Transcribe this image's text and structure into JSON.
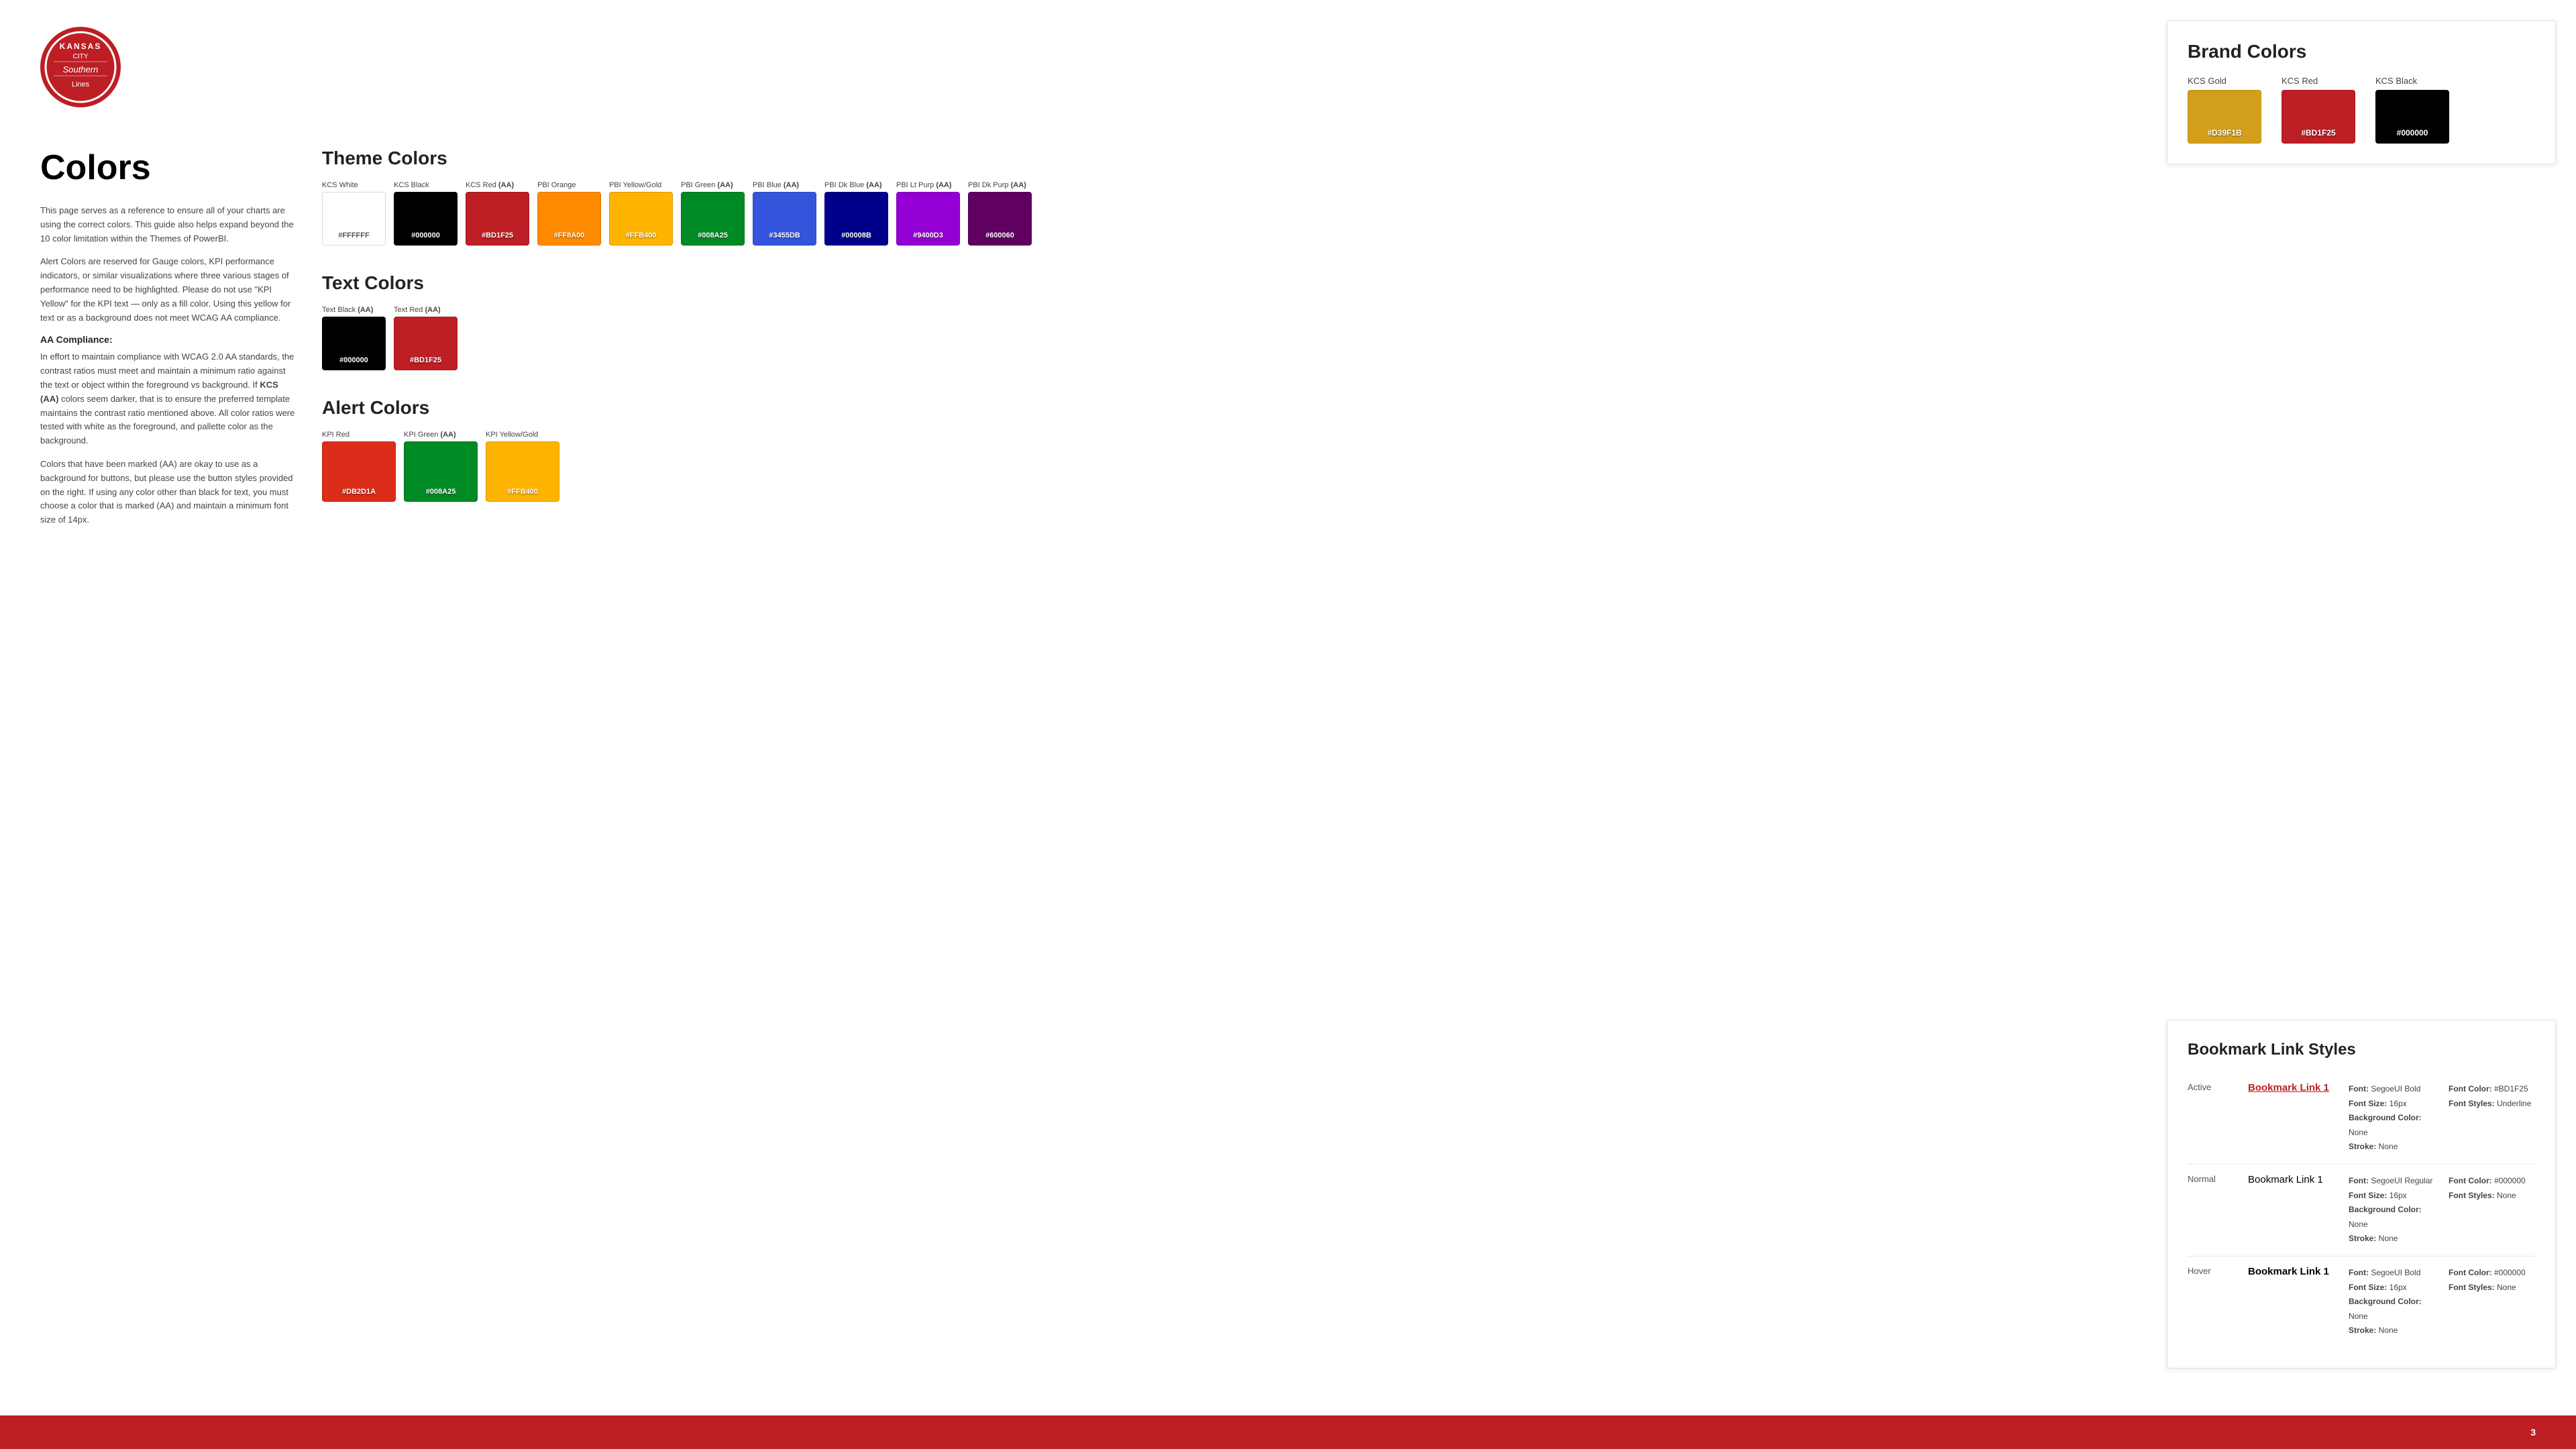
{
  "logo": {
    "line1": "KANSAS",
    "line2": "CITY",
    "line3": "SOUTHERN",
    "line4": "Lines"
  },
  "brand_colors": {
    "title": "Brand Colors",
    "swatches": [
      {
        "label": "KCS Gold",
        "hex": "#D39F1B",
        "display_hex": "#D39F1B"
      },
      {
        "label": "KCS Red",
        "hex": "#BD1F25",
        "display_hex": "#BD1F25"
      },
      {
        "label": "KCS Black",
        "hex": "#000000",
        "display_hex": "#000000"
      }
    ]
  },
  "colors_page": {
    "heading": "Colors",
    "description1": "This page serves as a reference to ensure all of your charts are using the correct colors. This guide also helps expand beyond the 10 color limitation within the Themes of PowerBI.",
    "description2": "Alert Colors are reserved for Gauge colors, KPI performance indicators, or similar visualizations where three various stages of performance need to be highlighted. Please do not use \"KPI Yellow\" for the KPI text — only as a fill color. Using this yellow for text or as a background does not meet WCAG AA compliance.",
    "aa_compliance_title": "AA Compliance:",
    "aa_compliance_text": "In effort to maintain compliance with WCAG 2.0 AA standards, the contrast ratios must meet and maintain a minimum ratio against the text or object within the foreground vs background. If KCS (AA) colors seem darker, that is to ensure the preferred template maintains the contrast ratio mentioned above. All color ratios were tested with white as the foreground, and pallette color as the background.",
    "colors_note": "Colors that have been marked (AA) are okay to use as a background for buttons, but please use the button styles provided on the right. If using any color other than black for text, you must choose a color that is marked (AA) and maintain a minimum font size of 14px."
  },
  "theme_colors": {
    "title": "Theme Colors",
    "swatches": [
      {
        "label": "KCS White",
        "aa": false,
        "hex": "#FFFFFF",
        "display_hex": "#FFFFFF",
        "text_dark": true
      },
      {
        "label": "KCS Black",
        "aa": false,
        "hex": "#000000",
        "display_hex": "#000000"
      },
      {
        "label": "KCS Red",
        "aa": true,
        "hex": "#BD1F25",
        "display_hex": "#BD1F25"
      },
      {
        "label": "PBI Orange",
        "aa": false,
        "hex": "#FF8A00",
        "display_hex": "#FF8A00"
      },
      {
        "label": "PBI Yellow/Gold",
        "aa": false,
        "hex": "#FFB400",
        "display_hex": "#FFB400"
      },
      {
        "label": "PBI Green",
        "aa": true,
        "hex": "#008A25",
        "display_hex": "#008A25"
      },
      {
        "label": "PBI Blue",
        "aa": true,
        "hex": "#3455DB",
        "display_hex": "#3455DB"
      },
      {
        "label": "PBI Dk Blue",
        "aa": true,
        "hex": "#00008B",
        "display_hex": "#00008B"
      },
      {
        "label": "PBI Lt Purp",
        "aa": true,
        "hex": "#9400D3",
        "display_hex": "#9400D3"
      },
      {
        "label": "PBI Dk Purp",
        "aa": true,
        "hex": "#600060",
        "display_hex": "#600060"
      }
    ]
  },
  "text_colors": {
    "title": "Text Colors",
    "swatches": [
      {
        "label": "Text Black",
        "aa": true,
        "hex": "#000000",
        "display_hex": "#000000"
      },
      {
        "label": "Text Red",
        "aa": true,
        "hex": "#BD1F25",
        "display_hex": "#BD1F25"
      }
    ]
  },
  "alert_colors": {
    "title": "Alert Colors",
    "swatches": [
      {
        "label": "KPI Red",
        "aa": false,
        "hex": "#DB2D1A",
        "display_hex": "#DB2D1A"
      },
      {
        "label": "KPI Green",
        "aa": true,
        "hex": "#008A25",
        "display_hex": "#008A25"
      },
      {
        "label": "KPI Yellow/Gold",
        "aa": false,
        "hex": "#FFB400",
        "display_hex": "#FFB400"
      }
    ]
  },
  "bookmark_link_styles": {
    "title": "Bookmark Link Styles",
    "states": [
      {
        "state": "Active",
        "preview_text": "Bookmark Link 1",
        "style": "active",
        "specs_left": [
          {
            "bold": "Font:",
            "value": " SegoeUI Bold"
          },
          {
            "bold": "Font Size:",
            "value": " 16px"
          },
          {
            "bold": "Background Color:",
            "value": " None"
          },
          {
            "bold": "Stroke:",
            "value": " None"
          }
        ],
        "specs_right": [
          {
            "bold": "Font Color:",
            "value": " #BD1F25"
          },
          {
            "bold": "Font Styles:",
            "value": " Underline"
          }
        ]
      },
      {
        "state": "Normal",
        "preview_text": "Bookmark Link 1",
        "style": "normal",
        "specs_left": [
          {
            "bold": "Font:",
            "value": " SegoeUI Regular"
          },
          {
            "bold": "Font Size:",
            "value": " 16px"
          },
          {
            "bold": "Background Color:",
            "value": " None"
          },
          {
            "bold": "Stroke:",
            "value": " None"
          }
        ],
        "specs_right": [
          {
            "bold": "Font Color:",
            "value": " #000000"
          },
          {
            "bold": "Font Styles:",
            "value": " None"
          }
        ]
      },
      {
        "state": "Hover",
        "preview_text": "Bookmark Link 1",
        "style": "hover",
        "specs_left": [
          {
            "bold": "Font:",
            "value": " SegoeUI Bold"
          },
          {
            "bold": "Font Size:",
            "value": " 16px"
          },
          {
            "bold": "Background Color:",
            "value": " None"
          },
          {
            "bold": "Stroke:",
            "value": " None"
          }
        ],
        "specs_right": [
          {
            "bold": "Font Color:",
            "value": " #000000"
          },
          {
            "bold": "Font Styles:",
            "value": " None"
          }
        ]
      }
    ]
  },
  "footer": {
    "page_number": "3"
  }
}
